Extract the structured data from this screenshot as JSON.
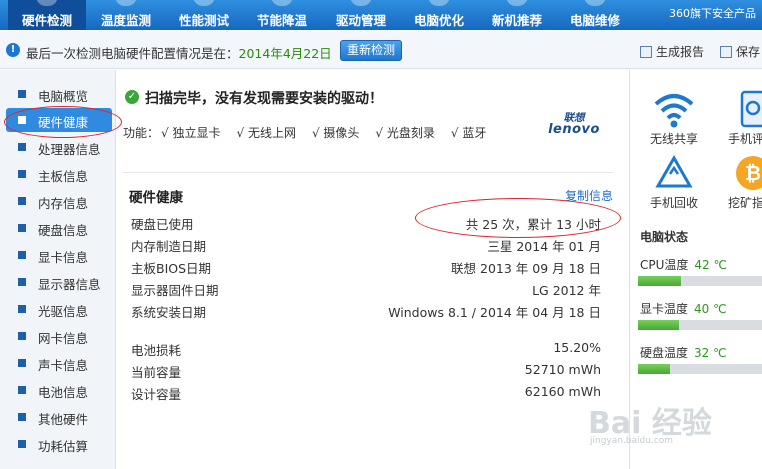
{
  "tabs": [
    {
      "label": "硬件检测",
      "active": true
    },
    {
      "label": "温度监测",
      "active": false
    },
    {
      "label": "性能测试",
      "active": false
    },
    {
      "label": "节能降温",
      "active": false
    },
    {
      "label": "驱动管理",
      "active": false
    },
    {
      "label": "电脑优化",
      "active": false
    },
    {
      "label": "新机推荐",
      "active": false
    },
    {
      "label": "电脑维修",
      "active": false
    }
  ],
  "brand": "360旗下安全产品",
  "infobar": {
    "icon": "!",
    "text": "最后一次检测电脑硬件配置情况是在：",
    "date": "2014年4月22日",
    "recheck_label": "重新检测",
    "report_label": "生成报告",
    "save_label": "保存"
  },
  "sidebar": {
    "items": [
      {
        "label": "电脑概览"
      },
      {
        "label": "硬件健康",
        "active": true
      },
      {
        "label": "处理器信息"
      },
      {
        "label": "主板信息"
      },
      {
        "label": "内存信息"
      },
      {
        "label": "硬盘信息"
      },
      {
        "label": "显卡信息"
      },
      {
        "label": "显示器信息"
      },
      {
        "label": "光驱信息"
      },
      {
        "label": "网卡信息"
      },
      {
        "label": "声卡信息"
      },
      {
        "label": "电池信息"
      },
      {
        "label": "其他硬件"
      },
      {
        "label": "功耗估算"
      }
    ]
  },
  "scan": {
    "title": "扫描完毕，没有发现需要安装的驱动！",
    "functions_label": "功能：",
    "functions": [
      "√ 独立显卡",
      "√ 无线上网",
      "√ 摄像头",
      "√ 光盘刻录",
      "√ 蓝牙"
    ],
    "logo_cn": "联想",
    "logo_en": "lenovo"
  },
  "health": {
    "title": "硬件健康",
    "copy_label": "复制信息",
    "rows": [
      {
        "key": "硬盘已使用",
        "value": "共 25 次，累计 13 小时"
      },
      {
        "key": "内存制造日期",
        "value": "三星 2014 年 01 月"
      },
      {
        "key": "主板BIOS日期",
        "value": "联想 2013 年 09 月 18 日"
      },
      {
        "key": "显示器固件日期",
        "value": "LG 2012 年"
      },
      {
        "key": "系统安装日期",
        "value": "Windows 8.1 / 2014 年 04 月 18 日"
      }
    ],
    "battery_rows": [
      {
        "key": "电池损耗",
        "value": "15.20%"
      },
      {
        "key": "当前容量",
        "value": "52710 mWh"
      },
      {
        "key": "设计容量",
        "value": "62160 mWh"
      }
    ]
  },
  "right_panel": {
    "tools": [
      {
        "label": "无线共享",
        "icon": "wifi-icon"
      },
      {
        "label": "手机评",
        "icon": "phone-icon"
      },
      {
        "label": "手机回收",
        "icon": "recycle-icon"
      },
      {
        "label": "挖矿指",
        "icon": "bitcoin-icon"
      }
    ],
    "status_title": "电脑状态",
    "temps": [
      {
        "label": "CPU温度",
        "value": "42 ℃",
        "level": 0.35
      },
      {
        "label": "显卡温度",
        "value": "40 ℃",
        "level": 0.33
      },
      {
        "label": "硬盘温度",
        "value": "32 ℃",
        "level": 0.26
      }
    ]
  },
  "watermark": {
    "text": "Bai 经验",
    "sub": "jingyan.baidu.com"
  },
  "colors": {
    "accent": "#2f8ae0",
    "ok": "#2a9a1a",
    "highlight": "#e0222a"
  }
}
